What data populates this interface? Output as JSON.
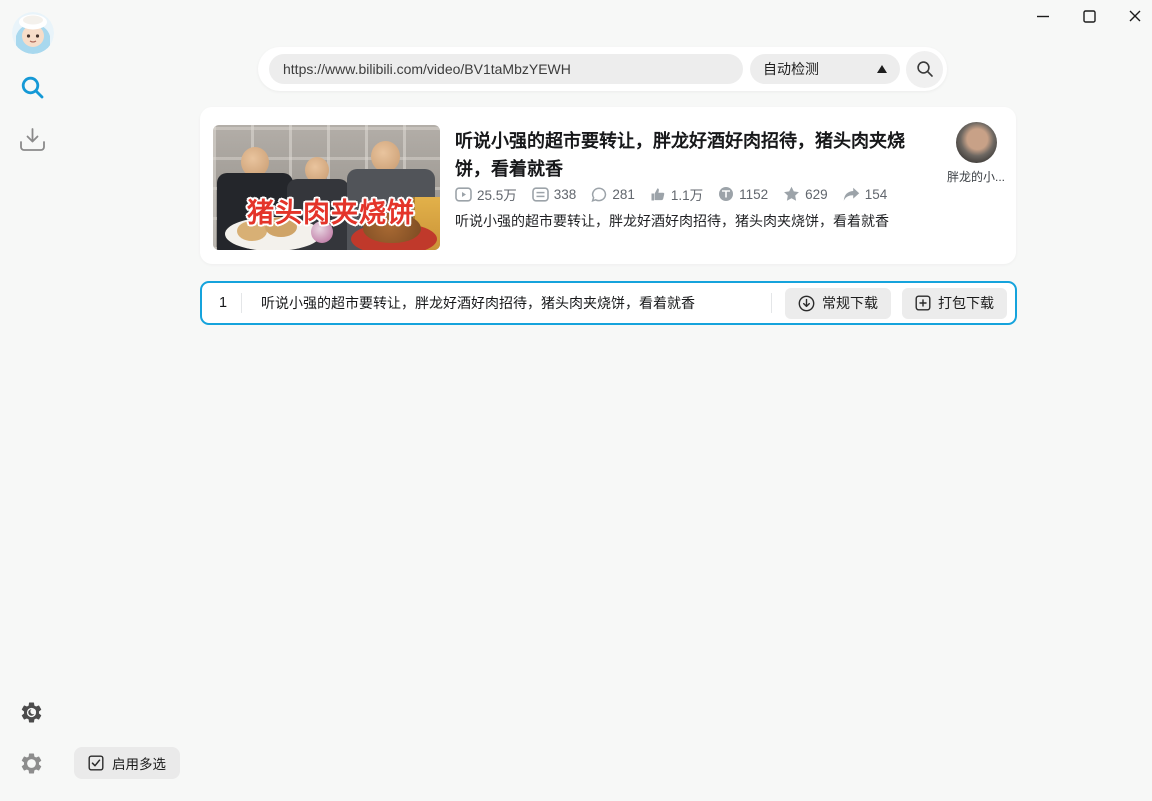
{
  "window": {
    "controls": {
      "minimize": "minimize",
      "maximize": "maximize",
      "close": "close"
    }
  },
  "search_bar": {
    "url_value": "https://www.bilibili.com/video/BV1taMbzYEWH",
    "mode_label": "自动检测"
  },
  "video_card": {
    "thumbnail_caption": "猪头肉夹烧饼",
    "title": "听说小强的超市要转让，胖龙好酒好肉招待，猪头肉夹烧饼，看着就香",
    "stats": [
      {
        "name": "play",
        "value": "25.5万"
      },
      {
        "name": "danmaku",
        "value": "338"
      },
      {
        "name": "comment",
        "value": "281"
      },
      {
        "name": "like",
        "value": "1.1万"
      },
      {
        "name": "coin",
        "value": "1152"
      },
      {
        "name": "favorite",
        "value": "629"
      },
      {
        "name": "share",
        "value": "154"
      }
    ],
    "description": "听说小强的超市要转让，胖龙好酒好肉招待，猪头肉夹烧饼，看着就香",
    "uploader_name": "胖龙的小..."
  },
  "download_row": {
    "index": "1",
    "title": "听说小强的超市要转让，胖龙好酒好肉招待，猪头肉夹烧饼，看着就香",
    "buttons": {
      "regular": "常规下载",
      "package": "打包下载"
    }
  },
  "footer": {
    "multi_select_label": "启用多选"
  },
  "colors": {
    "accent_blue": "#15a3dc",
    "caption_red": "#e4342a"
  }
}
